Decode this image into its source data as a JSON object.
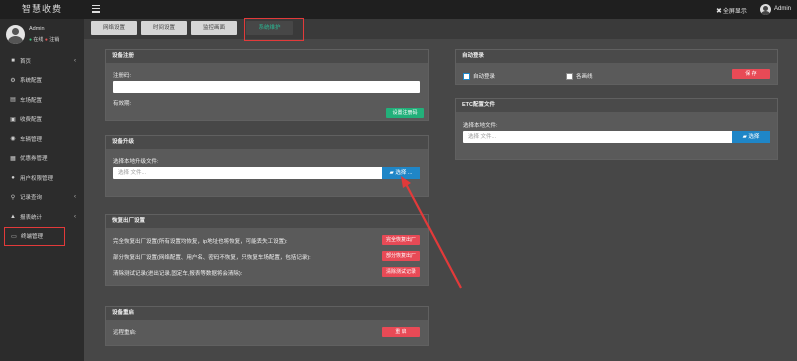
{
  "app": {
    "brand": "智慧收费"
  },
  "topbar": {
    "fullscreen": "全屏显示",
    "admin": "Admin"
  },
  "user": {
    "name": "Admin",
    "online": "在线",
    "logout": "注销"
  },
  "sidebar": {
    "items": [
      {
        "icon": "home-icon",
        "glyph": "■",
        "label": "首页",
        "arrow": true
      },
      {
        "icon": "settings-icon",
        "glyph": "⚙",
        "label": "系统配置",
        "arrow": false
      },
      {
        "icon": "lane-icon",
        "glyph": "▤",
        "label": "车场配置",
        "arrow": false
      },
      {
        "icon": "fee-icon",
        "glyph": "▣",
        "label": "收费配置",
        "arrow": false
      },
      {
        "icon": "car-icon",
        "glyph": "◉",
        "label": "车辆管理",
        "arrow": false
      },
      {
        "icon": "coupon-icon",
        "glyph": "▦",
        "label": "优惠券管理",
        "arrow": false
      },
      {
        "icon": "user-icon",
        "glyph": "●",
        "label": "用户权限管理",
        "arrow": false
      },
      {
        "icon": "search-icon",
        "glyph": "⚲",
        "label": "记录查询",
        "arrow": true
      },
      {
        "icon": "chart-icon",
        "glyph": "▲",
        "label": "报表统计",
        "arrow": true
      },
      {
        "icon": "monitor-icon",
        "glyph": "▭",
        "label": "终端管理",
        "arrow": false
      }
    ]
  },
  "tabs": [
    {
      "label": "网络设置"
    },
    {
      "label": "时间设置"
    },
    {
      "label": "监控画面"
    },
    {
      "label": "系统维护"
    }
  ],
  "register": {
    "title": "设备注册",
    "code_label": "注册码:",
    "expire_label": "有效期:",
    "button": "设置注册码"
  },
  "upgrade": {
    "title": "设备升级",
    "file_label": "选择本地升级文件:",
    "placeholder": "选择 文件...",
    "choose": "选择 ..."
  },
  "factory": {
    "title": "恢复出厂设置",
    "rows": [
      {
        "text": "完全恢复出厂设置(所有设置均恢复，ip地址也将恢复，可能丢失工设置):",
        "button": "完全恢复出厂"
      },
      {
        "text": "部分恢复出厂设置(网络配置、用户名、密码不恢复，只恢复车场配置，包括记录):",
        "button": "部分恢复出厂"
      },
      {
        "text": "清除测试记录(进出记录,固定车,报表等数据将会清除):",
        "button": "清除测试记录"
      }
    ]
  },
  "restart": {
    "title": "设备重启",
    "label": "远程重启:",
    "button": "重    启"
  },
  "autologin": {
    "title": "自动登录",
    "opt1": "自动登录",
    "opt2": "各画线",
    "button": "保    存"
  },
  "etc": {
    "title": "ETC配置文件",
    "file_label": "选择本地文件:",
    "placeholder": "选择 文件...",
    "choose": "选择"
  },
  "colors": {
    "accent": "#2bb491",
    "highlight": "#e23a3a",
    "primary": "#1f86c7",
    "danger": "#e84a56"
  }
}
